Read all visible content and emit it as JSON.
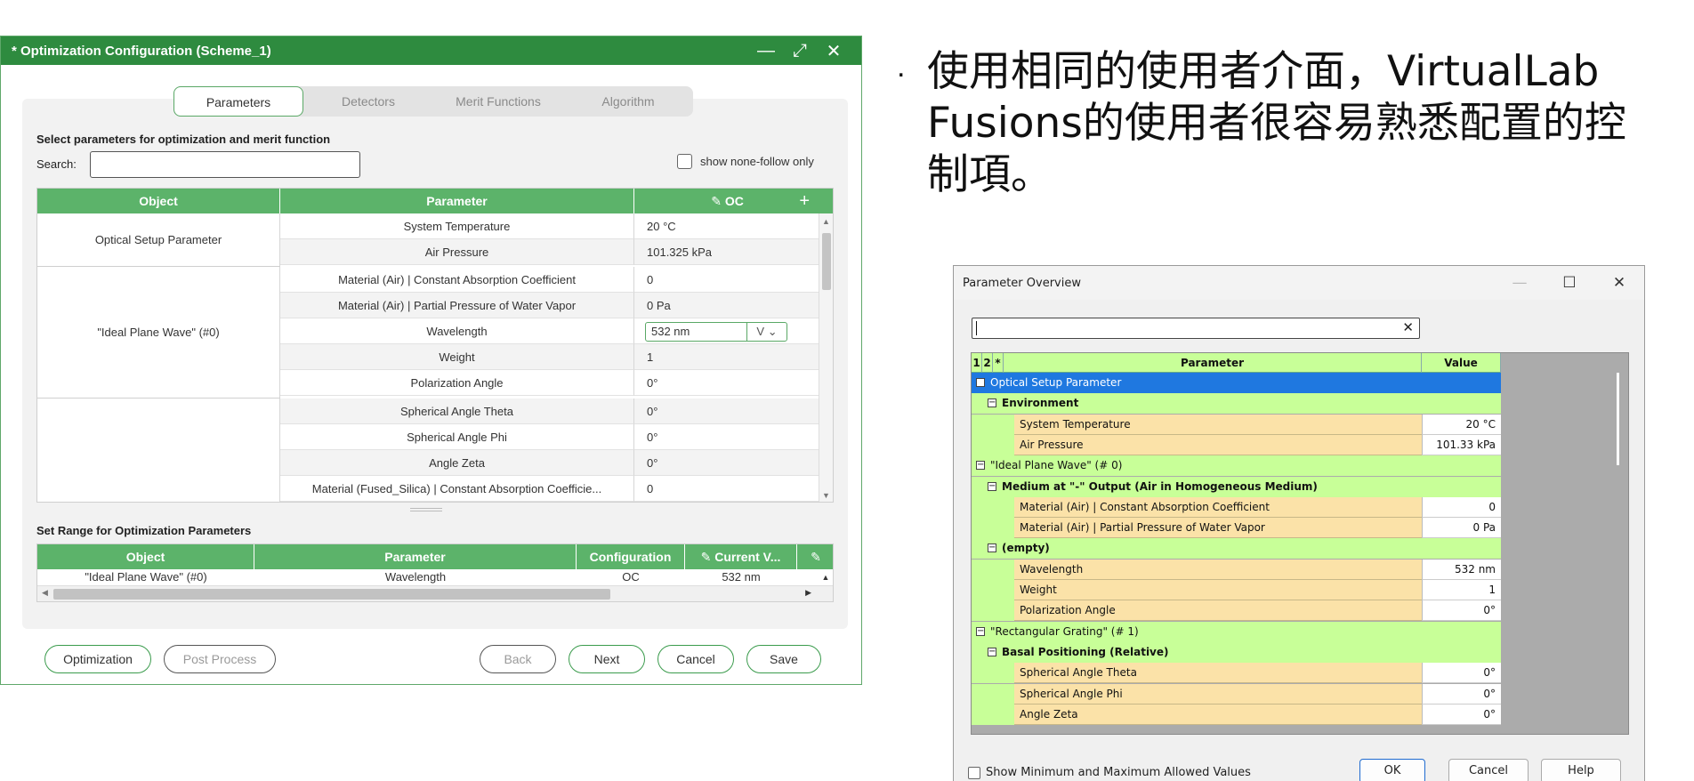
{
  "opt_dialog": {
    "title": "* Optimization Configuration (Scheme_1)",
    "titlebar_icons": [
      "minimize-icon",
      "maximize-icon",
      "close-icon"
    ],
    "tabs": [
      "Parameters",
      "Detectors",
      "Merit Functions",
      "Algorithm"
    ],
    "active_tab": "Parameters",
    "select_heading": "Select parameters for optimization and merit function",
    "search_label": "Search:",
    "search_value": "",
    "show_none_follow": "show none-follow only",
    "table": {
      "headers": {
        "object": "Object",
        "parameter": "Parameter",
        "oc": "OC"
      },
      "groups": [
        {
          "object": "Optical Setup Parameter"
        },
        {
          "object": "\"Ideal Plane Wave\" (#0)"
        },
        {
          "object": ""
        }
      ],
      "rows": [
        {
          "parameter": "System Temperature",
          "value": "20 °C"
        },
        {
          "parameter": "Air Pressure",
          "value": "101.325 kPa"
        },
        {
          "parameter": "Material (Air) | Constant Absorption Coefficient",
          "value": "0"
        },
        {
          "parameter": "Material (Air) | Partial Pressure of Water Vapor",
          "value": "0 Pa"
        },
        {
          "parameter": "Wavelength",
          "value": "532 nm",
          "unit_selector": "V"
        },
        {
          "parameter": "Weight",
          "value": "1"
        },
        {
          "parameter": "Polarization Angle",
          "value": "0°"
        },
        {
          "parameter": "Spherical Angle Theta",
          "value": "0°"
        },
        {
          "parameter": "Spherical Angle Phi",
          "value": "0°"
        },
        {
          "parameter": "Angle Zeta",
          "value": "0°"
        },
        {
          "parameter": "Material (Fused_Silica) | Constant Absorption Coefficie...",
          "value": "0"
        }
      ]
    },
    "range_heading": "Set Range for Optimization Parameters",
    "range_table": {
      "headers": [
        "Object",
        "Parameter",
        "Configuration",
        "Current V..."
      ],
      "row": [
        "\"Ideal Plane Wave\" (#0)",
        "Wavelength",
        "OC",
        "532 nm"
      ]
    },
    "buttons": {
      "optimization": "Optimization",
      "post_process": "Post Process",
      "back": "Back",
      "next": "Next",
      "cancel": "Cancel",
      "save": "Save"
    }
  },
  "bullet_text": "使用相同的使用者介面，VirtualLab Fusions的使用者很容易熟悉配置的控制項。",
  "bullet_marker": ".",
  "param_overview": {
    "title": "Parameter Overview",
    "search_value": "",
    "grid_headers": [
      "1",
      "2",
      "*",
      "Parameter",
      "Value"
    ],
    "rows": [
      {
        "kind": "sel",
        "level": 0,
        "label": "Optical Setup Parameter"
      },
      {
        "kind": "grp",
        "level": 1,
        "label": "Environment"
      },
      {
        "kind": "leaf",
        "label": "System Temperature",
        "value": "20 °C"
      },
      {
        "kind": "leaf",
        "label": "Air Pressure",
        "value": "101.33 kPa"
      },
      {
        "kind": "grp",
        "level": 0,
        "label": "\"Ideal Plane Wave\" (# 0)"
      },
      {
        "kind": "grp",
        "level": 1,
        "label": "Medium at \"-\" Output (Air in Homogeneous Medium)"
      },
      {
        "kind": "leaf",
        "label": "Material (Air) | Constant Absorption Coefficient",
        "value": "0"
      },
      {
        "kind": "leaf",
        "label": "Material (Air) | Partial Pressure of Water Vapor",
        "value": "0 Pa"
      },
      {
        "kind": "grp",
        "level": 1,
        "label": "(empty)"
      },
      {
        "kind": "leaf",
        "label": "Wavelength",
        "value": "532 nm"
      },
      {
        "kind": "leaf",
        "label": "Weight",
        "value": "1"
      },
      {
        "kind": "leaf",
        "label": "Polarization Angle",
        "value": "0°"
      },
      {
        "kind": "grp",
        "level": 0,
        "label": "\"Rectangular Grating\" (# 1)"
      },
      {
        "kind": "grp",
        "level": 1,
        "label": "Basal Positioning (Relative)"
      },
      {
        "kind": "leaf",
        "label": "Spherical Angle Theta",
        "value": "0°"
      },
      {
        "kind": "leaf",
        "label": "Spherical Angle Phi",
        "value": "0°"
      },
      {
        "kind": "leaf",
        "label": "Angle Zeta",
        "value": "0°"
      }
    ],
    "show_minmax": "Show Minimum and Maximum Allowed Values",
    "buttons": {
      "ok": "OK",
      "cancel": "Cancel",
      "help": "Help"
    }
  },
  "colors": {
    "title_green": "#2e8b3f",
    "header_green": "#5cb36a",
    "grid_green": "#c8ff98",
    "leaf_tan": "#fbe2a8",
    "select_blue": "#1f78e0"
  }
}
